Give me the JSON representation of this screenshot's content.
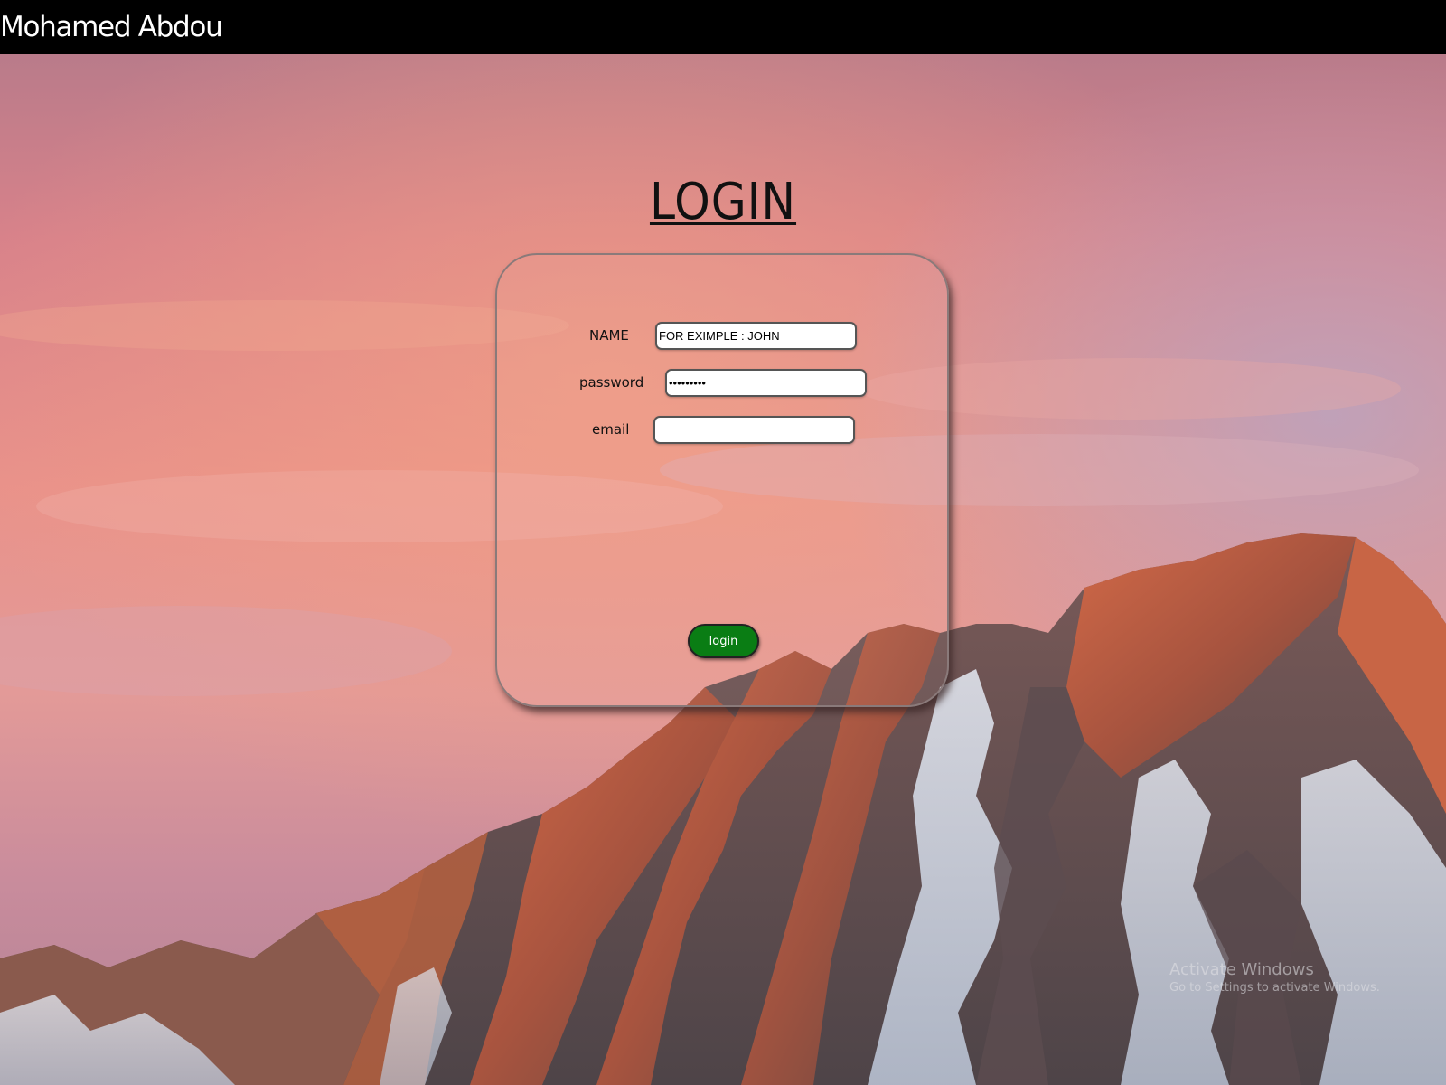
{
  "header": {
    "title": "Mohamed Abdou"
  },
  "login_form": {
    "title": "LOGIN",
    "name_label": "NAME",
    "name_placeholder": "FOR EXIMPLE : JOHN",
    "password_label": "password",
    "password_value": "123456789",
    "email_label": "email",
    "email_value": "",
    "submit_label": "login"
  },
  "os_watermark": {
    "line1": "Activate Windows",
    "line2": "Go to Settings to activate Windows."
  },
  "colors": {
    "header_bg": "#000000",
    "button_bg": "#0a7d14",
    "sky": "#d98a86"
  }
}
